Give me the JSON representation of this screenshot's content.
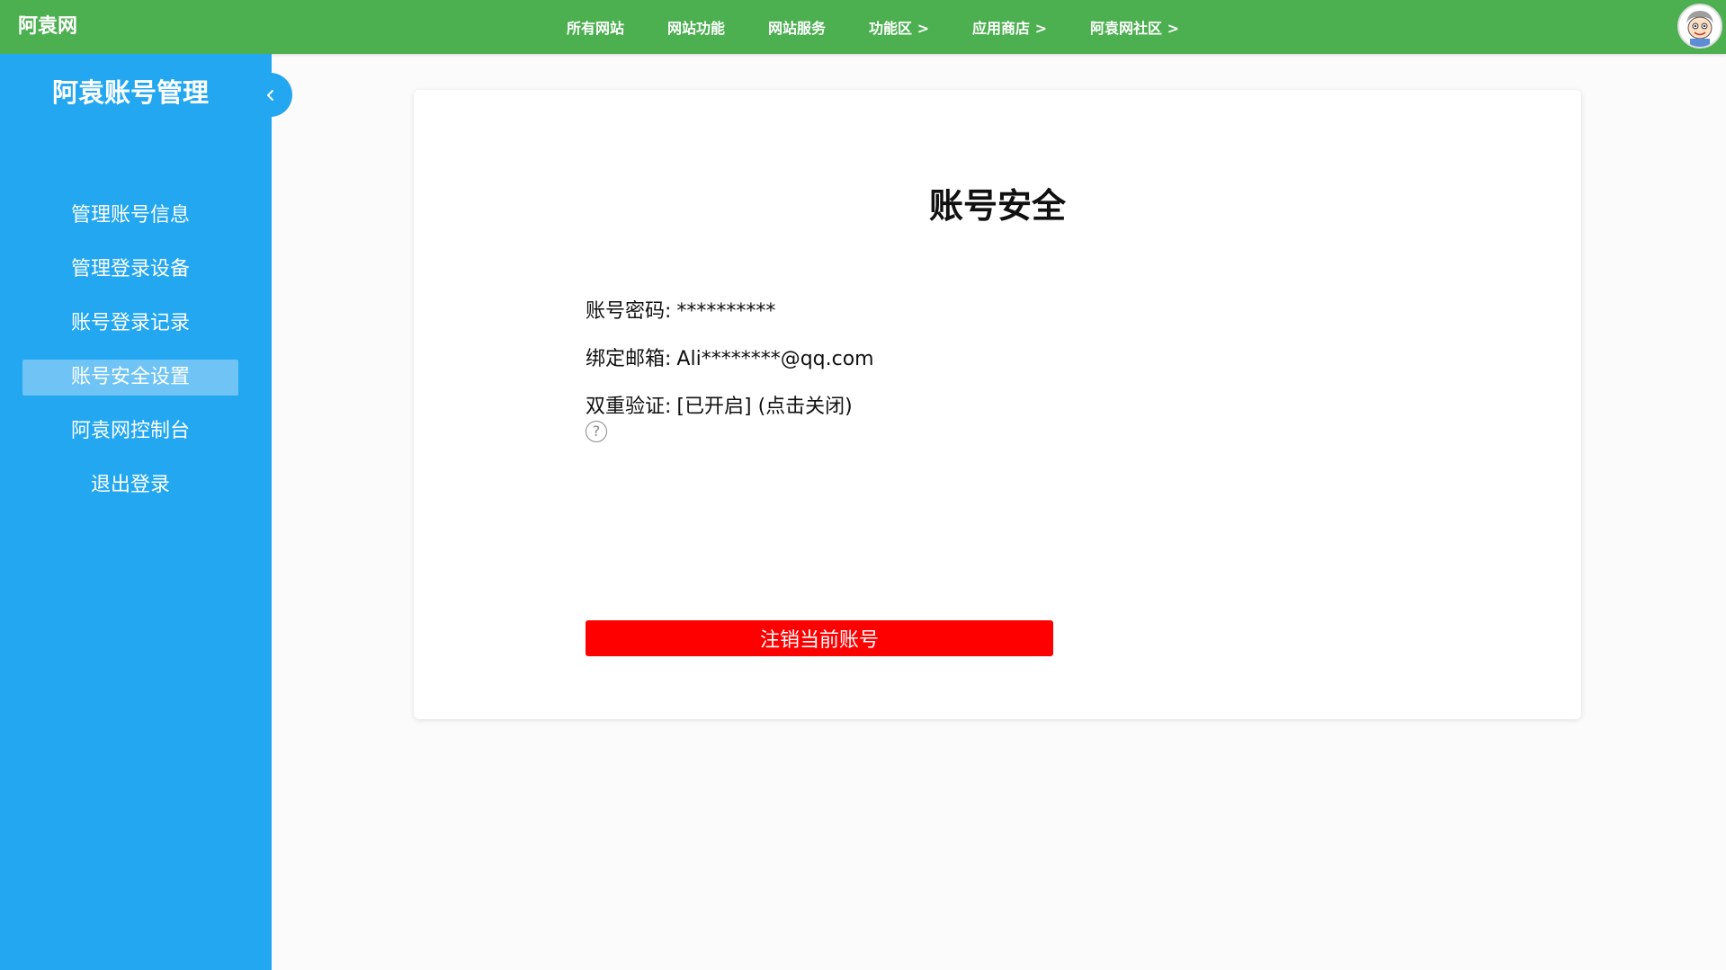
{
  "header": {
    "brand": "阿袁网",
    "nav": [
      "所有网站",
      "网站功能",
      "网站服务",
      "功能区 >",
      "应用商店 >",
      "阿袁网社区 >"
    ],
    "avatar_icon": "cartoon-avatar-icon"
  },
  "sidebar": {
    "title": "阿袁账号管理",
    "collapse_icon": "chevron-left-icon",
    "items": [
      {
        "label": "管理账号信息",
        "active": false
      },
      {
        "label": "管理登录设备",
        "active": false
      },
      {
        "label": "账号登录记录",
        "active": false
      },
      {
        "label": "账号安全设置",
        "active": true
      },
      {
        "label": "阿袁网控制台",
        "active": false
      },
      {
        "label": "退出登录",
        "active": false
      }
    ]
  },
  "main": {
    "title": "账号安全",
    "password": {
      "label": "账号密码:",
      "value": "**********"
    },
    "email": {
      "label": "绑定邮箱:",
      "value": "Ali********@qq.com"
    },
    "two_factor": {
      "label": "双重验证:",
      "status": "[已开启]",
      "action": "(点击关闭)"
    },
    "help_icon": "?",
    "delete_account_label": "注销当前账号"
  },
  "colors": {
    "topbar": "#4caf50",
    "sidebar": "#22a7f0",
    "active_item": "#6fc4f5",
    "danger": "#ff0000"
  }
}
